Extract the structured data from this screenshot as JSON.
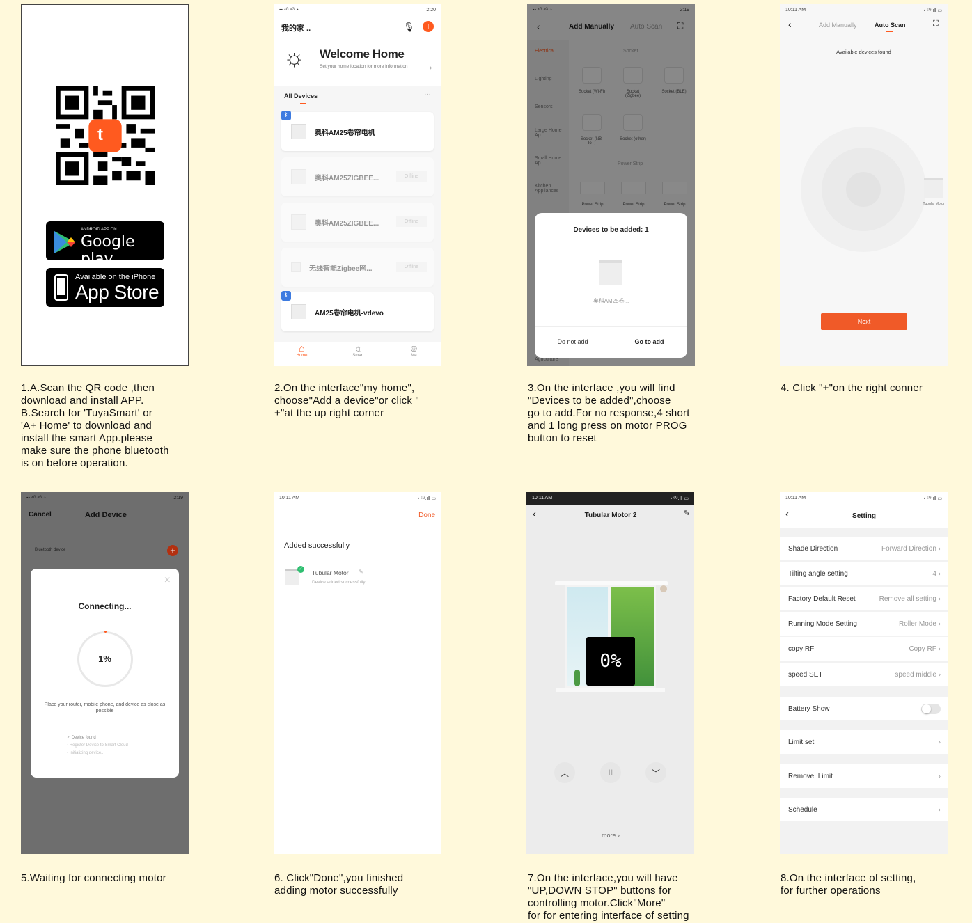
{
  "captions": {
    "c1": "1.A.Scan the QR code ,then\ndownload and install APP.\nB.Search for 'TuyaSmart' or\n'A+ Home' to download and\ninstall the smart App.please\nmake sure the phone bluetooth\nis on before operation.",
    "c2": "2.On the interface\"my home\",\nchoose\"Add a device\"or click \"\n+\"at the up right corner",
    "c3": "3.On the interface ,you will find\n \"Devices to be added\",choose\ngo to add.For no response,4 short\nand 1 long press on motor PROG\nbutton to reset",
    "c4": "4. Click \"+\"on the right conner",
    "c5": "5.Waiting for connecting motor",
    "c6": "6. Click\"Done\",you finished\nadding motor successfully",
    "c7": "7.On the interface,you will have\n\"UP,DOWN STOP\" buttons for\ncontrolling motor.Click\"More\"\nfor for entering interface of setting",
    "c8": "8.On the interface of setting,\nfor further operations"
  },
  "p1": {
    "gp_small": "ANDROID APP ON",
    "gp_big": "Google play",
    "as_small": "Available on the iPhone",
    "as_big": "App Store",
    "logo": "t"
  },
  "p2": {
    "status_time": "2:20",
    "home": "我的家 ..",
    "welcome": "Welcome Home",
    "sub": "Set your home location for more information",
    "all": "All Devices",
    "devices": [
      "奥科AM25卷帘电机",
      "奥科AM25ZIGBEE...",
      "奥科AM25ZIGBEE...",
      "无线智能Zigbee网...",
      "AM25卷帘电机-vdevo"
    ],
    "offline": "Offline",
    "tabs": [
      "Home",
      "Smart",
      "Me"
    ],
    "more": "···"
  },
  "p3": {
    "status_time": "2:19",
    "tab1": "Add Manually",
    "tab2": "Auto Scan",
    "cats": [
      "Electrical",
      "Lighting",
      "Sensors",
      "Large Home Ap...",
      "Small Home Ap...",
      "Kitchen Appliances"
    ],
    "agri": "Agriculture",
    "socket": "Socket",
    "socket_items": [
      "Socket (Wi-Fi)",
      "Socket (Zigbee)",
      "Socket (BLE)",
      "Socket (NB-IoT)",
      "Socket (other)"
    ],
    "power": "Power Strip",
    "power_items": [
      "Power Strip",
      "Power Strip",
      "Power Strip"
    ],
    "dlg_title": "Devices to be added: 1",
    "dlg_dev": "奥科AM25卷...",
    "no": "Do not add",
    "go": "Go to add"
  },
  "p4": {
    "status_time": "10:11 AM",
    "tab1": "Add Manually",
    "tab2": "Auto Scan",
    "found": "Available devices found",
    "dev": "Tubular Motor",
    "next": "Next"
  },
  "p5": {
    "status_time": "2:19",
    "cancel": "Cancel",
    "title": "Add Device",
    "bt": "Bluetooth device",
    "connecting": "Connecting...",
    "pct": "1%",
    "hint": "Place your router, mobile phone, and device as close as possible",
    "steps": [
      "Device found",
      "Register Device to Smart Cloud",
      "Initializing device..."
    ],
    "close": "×"
  },
  "p6": {
    "status_time": "10:11 AM",
    "done": "Done",
    "added": "Added successfully",
    "dev": "Tubular Motor",
    "sub": "Device added successfully"
  },
  "p7": {
    "status_time": "10:11 AM",
    "title": "Tubular Motor 2",
    "pct": "0%",
    "more": "more",
    "up": "︿",
    "stop": "II",
    "down": "﹀"
  },
  "p8": {
    "status_time": "10:11 AM",
    "title": "Setting",
    "rows": [
      {
        "k": "Shade Direction",
        "v": "Forward Direction"
      },
      {
        "k": "Tilting angle setting",
        "v": "4"
      },
      {
        "k": "Factory Default Reset",
        "v": "Remove all setting"
      },
      {
        "k": "Running Mode Setting",
        "v": "Roller Mode"
      },
      {
        "k": "copy RF",
        "v": "Copy RF"
      },
      {
        "k": "speed SET",
        "v": "speed middle"
      }
    ],
    "battery": "Battery Show",
    "limit": "Limit set",
    "remove": "Remove  Limit",
    "schedule": "Schedule"
  }
}
